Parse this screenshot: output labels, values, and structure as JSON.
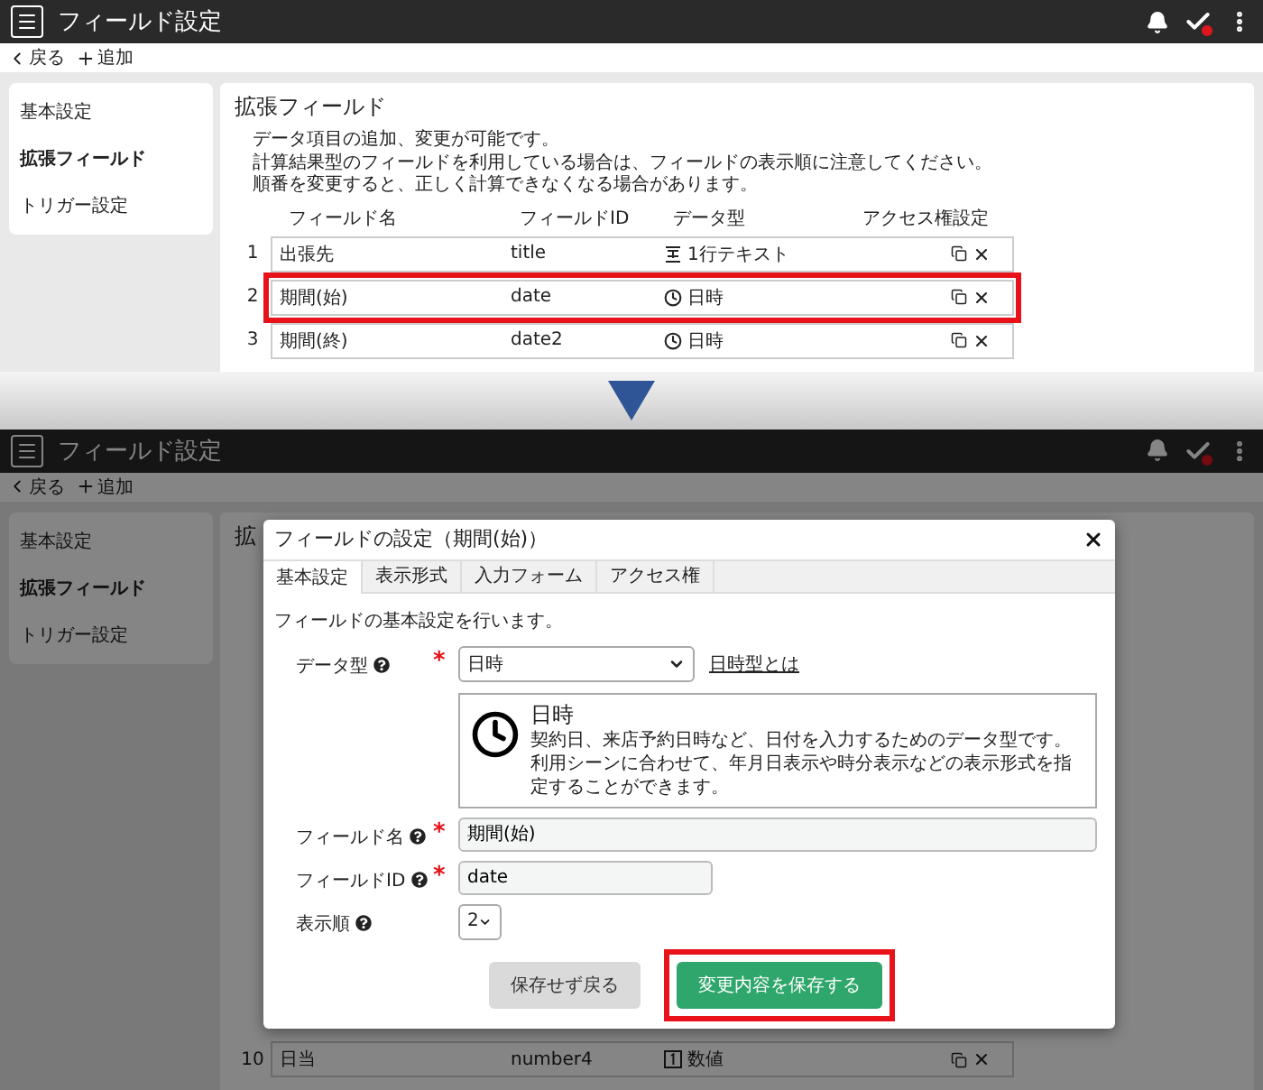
{
  "top_screen": {
    "header": {
      "title": "フィールド設定"
    },
    "toolbar": {
      "back": "戻る",
      "add": "追加"
    },
    "sidebar": [
      {
        "label": "基本設定",
        "selected": false
      },
      {
        "label": "拡張フィールド",
        "selected": true
      },
      {
        "label": "トリガー設定",
        "selected": false
      }
    ],
    "section": {
      "title": "拡張フィールド",
      "description": [
        "データ項目の追加、変更が可能です。",
        "計算結果型のフィールドを利用している場合は、フィールドの表示順に注意してください。",
        "順番を変更すると、正しく計算できなくなる場合があります。"
      ]
    },
    "table": {
      "columns": [
        "フィールド名",
        "フィールドID",
        "データ型",
        "アクセス権設定"
      ],
      "rows": [
        {
          "number": "1",
          "name": "出張先",
          "id": "title",
          "type": "1行テキスト",
          "kind": "text",
          "highlighted": false
        },
        {
          "number": "2",
          "name": "期間(始)",
          "id": "date",
          "type": "日時",
          "kind": "datetime",
          "highlighted": true
        },
        {
          "number": "3",
          "name": "期間(終)",
          "id": "date2",
          "type": "日時",
          "kind": "datetime",
          "highlighted": false
        }
      ]
    }
  },
  "bottom_screen": {
    "header": {
      "title": "フィールド設定"
    },
    "toolbar": {
      "back": "戻る",
      "add": "追加"
    },
    "sidebar": [
      {
        "label": "基本設定",
        "selected": false
      },
      {
        "label": "拡張フィールド",
        "selected": true
      },
      {
        "label": "トリガー設定",
        "selected": false
      }
    ],
    "section": {
      "title": "拡"
    },
    "table": {
      "rows": [
        {
          "number": "10",
          "name": "日当",
          "id": "number4",
          "type": "数値",
          "kind": "number",
          "highlighted": false
        }
      ]
    },
    "dialog": {
      "title": "フィールドの設定（期間(始)）",
      "tabs": [
        {
          "label": "基本設定",
          "selected": true
        },
        {
          "label": "表示形式",
          "selected": false
        },
        {
          "label": "入力フォーム",
          "selected": false
        },
        {
          "label": "アクセス権",
          "selected": false
        }
      ],
      "intro": "フィールドの基本設定を行います。",
      "required_mark": "*",
      "fields": [
        {
          "kind": "type-select",
          "label": "データ型",
          "required": true,
          "value": "日時",
          "link": "日時型とは",
          "info": {
            "title": "日時",
            "description": [
              "契約日、来店予約日時など、日付を入力するためのデータ型です。",
              "利用シーンに合わせて、年月日表示や時分表示などの表示形式を指定することができます。"
            ]
          }
        },
        {
          "kind": "text",
          "label": "フィールド名",
          "required": true,
          "value": "期間(始)"
        },
        {
          "kind": "short-text",
          "label": "フィールドID",
          "required": true,
          "value": "date"
        },
        {
          "kind": "order-select",
          "label": "表示順",
          "required": false,
          "value": "2"
        }
      ],
      "buttons": [
        {
          "label": "保存せず戻る",
          "kind": "secondary",
          "highlighted": false
        },
        {
          "label": "変更内容を保存する",
          "kind": "primary",
          "highlighted": true
        }
      ]
    }
  }
}
